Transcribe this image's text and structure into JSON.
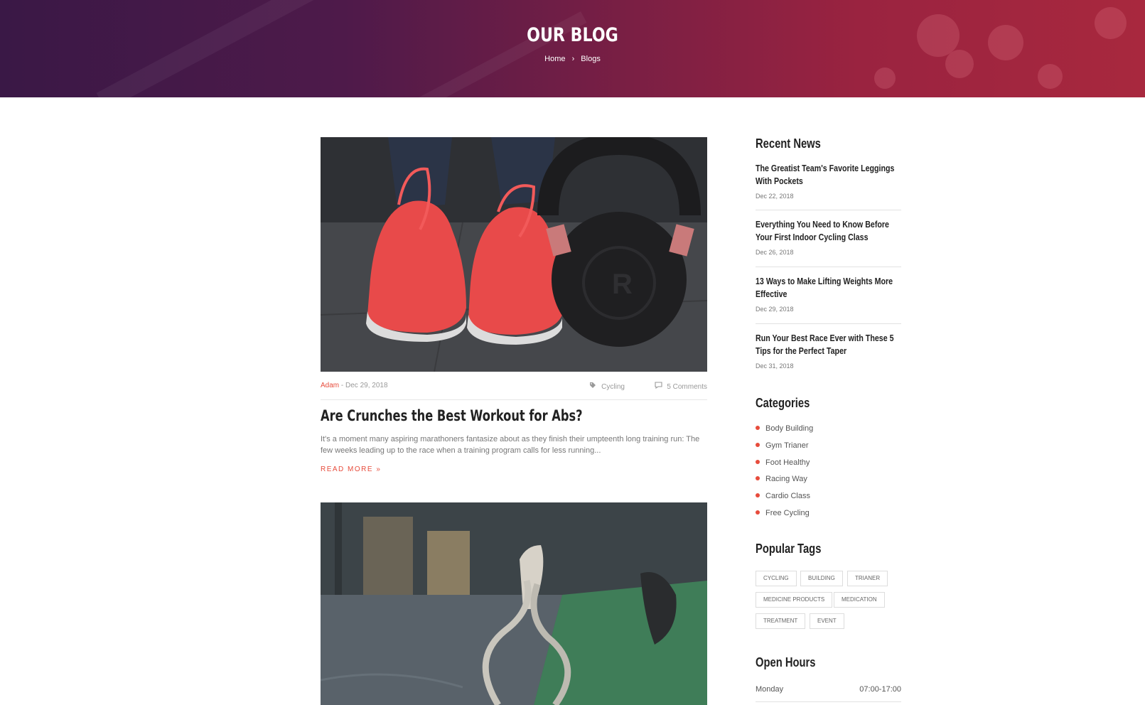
{
  "hero": {
    "title": "OUR BLOG",
    "breadcrumb_home": "Home",
    "breadcrumb_sep": "›",
    "breadcrumb_current": "Blogs"
  },
  "post": {
    "author": "Adam",
    "date": "- Dec 29, 2018",
    "category": "Cycling",
    "comments": "5 Comments",
    "title": "Are Crunches the Best Workout for Abs?",
    "excerpt": "It's a moment many aspiring marathoners fantasize about as they finish their umpteenth long training run: The few weeks leading up to the race when a training program calls for less running...",
    "read_more": "READ MORE »"
  },
  "sidebar": {
    "recent_heading": "Recent News",
    "recent": [
      {
        "title": "The Greatist Team's Favorite Leggings With Pockets",
        "date": "Dec 22, 2018"
      },
      {
        "title": "Everything You Need to Know Before Your First Indoor Cycling Class",
        "date": "Dec 26, 2018"
      },
      {
        "title": "13 Ways to Make Lifting Weights More Effective",
        "date": "Dec 29, 2018"
      },
      {
        "title": "Run Your Best Race Ever with These 5 Tips for the Perfect Taper",
        "date": "Dec 31, 2018"
      }
    ],
    "categories_heading": "Categories",
    "categories": [
      "Body Building",
      "Gym Trianer",
      "Foot Healthy",
      "Racing Way",
      "Cardio Class",
      "Free Cycling"
    ],
    "tags_heading": "Popular Tags",
    "tags": [
      "CYCLING",
      "BUILDING",
      "TRIANER",
      "MEDICINE PRODUCTS",
      "MEDICATION",
      "TREATMENT",
      "EVENT"
    ],
    "hours_heading": "Open Hours",
    "hours": [
      {
        "day": "Monday",
        "time": "07:00-17:00"
      }
    ]
  },
  "colors": {
    "accent": "#e74c3c",
    "hero_left": "#3a1846",
    "hero_right": "#a8283e"
  }
}
